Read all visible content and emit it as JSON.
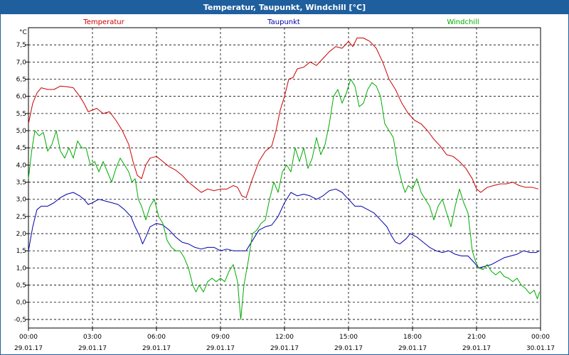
{
  "window": {
    "title": "Temperatur, Taupunkt, Windchill [°C]"
  },
  "chart_data": {
    "type": "line",
    "title": "Temperatur, Taupunkt, Windchill [°C]",
    "ylabel": "°C",
    "xlabel": "",
    "ylim": [
      -0.75,
      8.0
    ],
    "y_ticks": [
      -0.5,
      0.0,
      0.5,
      1.0,
      1.5,
      2.0,
      2.5,
      3.0,
      3.5,
      4.0,
      4.5,
      5.0,
      5.5,
      6.0,
      6.5,
      7.0,
      7.5
    ],
    "y_tick_labels": [
      "-0,5",
      "0,0",
      "0,5",
      "1,0",
      "1,5",
      "2,0",
      "2,5",
      "3,0",
      "3,5",
      "4,0",
      "4,5",
      "5,0",
      "5,5",
      "6,0",
      "6,5",
      "7,0",
      "7,5"
    ],
    "xlim": [
      0,
      24
    ],
    "x_ticks": [
      0,
      3,
      6,
      9,
      12,
      15,
      18,
      21,
      24
    ],
    "x_tick_labels": [
      {
        "time": "00:00",
        "date": "29.01.17"
      },
      {
        "time": "03:00",
        "date": "29.01.17"
      },
      {
        "time": "06:00",
        "date": "29.01.17"
      },
      {
        "time": "09:00",
        "date": "29.01.17"
      },
      {
        "time": "12:00",
        "date": "29.01.17"
      },
      {
        "time": "15:00",
        "date": "29.01.17"
      },
      {
        "time": "18:00",
        "date": "29.01.17"
      },
      {
        "time": "21:00",
        "date": "29.01.17"
      },
      {
        "time": "00:00",
        "date": "30.01.17"
      }
    ],
    "grid": true,
    "legend_position": "top",
    "series": [
      {
        "name": "Temperatur",
        "color": "#cc0000",
        "points": [
          [
            0,
            5.2
          ],
          [
            0.2,
            5.8
          ],
          [
            0.4,
            6.1
          ],
          [
            0.6,
            6.25
          ],
          [
            0.9,
            6.2
          ],
          [
            1.2,
            6.2
          ],
          [
            1.5,
            6.3
          ],
          [
            1.8,
            6.28
          ],
          [
            2.1,
            6.25
          ],
          [
            2.4,
            6.0
          ],
          [
            2.6,
            5.8
          ],
          [
            2.8,
            5.55
          ],
          [
            3.0,
            5.6
          ],
          [
            3.2,
            5.65
          ],
          [
            3.5,
            5.5
          ],
          [
            3.8,
            5.55
          ],
          [
            4.1,
            5.3
          ],
          [
            4.4,
            5.0
          ],
          [
            4.7,
            4.6
          ],
          [
            4.9,
            4.1
          ],
          [
            5.1,
            3.7
          ],
          [
            5.3,
            3.6
          ],
          [
            5.5,
            4.0
          ],
          [
            5.7,
            4.2
          ],
          [
            6.0,
            4.25
          ],
          [
            6.3,
            4.1
          ],
          [
            6.6,
            3.95
          ],
          [
            6.9,
            3.85
          ],
          [
            7.2,
            3.7
          ],
          [
            7.5,
            3.5
          ],
          [
            7.8,
            3.35
          ],
          [
            8.1,
            3.2
          ],
          [
            8.4,
            3.3
          ],
          [
            8.7,
            3.25
          ],
          [
            9.0,
            3.3
          ],
          [
            9.3,
            3.3
          ],
          [
            9.6,
            3.4
          ],
          [
            9.8,
            3.35
          ],
          [
            10.0,
            3.1
          ],
          [
            10.2,
            3.05
          ],
          [
            10.5,
            3.6
          ],
          [
            10.8,
            4.1
          ],
          [
            11.1,
            4.4
          ],
          [
            11.4,
            4.55
          ],
          [
            11.6,
            5.0
          ],
          [
            11.8,
            5.6
          ],
          [
            12.0,
            6.0
          ],
          [
            12.2,
            6.5
          ],
          [
            12.4,
            6.55
          ],
          [
            12.6,
            6.8
          ],
          [
            12.9,
            6.85
          ],
          [
            13.2,
            7.0
          ],
          [
            13.5,
            6.9
          ],
          [
            13.8,
            7.1
          ],
          [
            14.1,
            7.3
          ],
          [
            14.4,
            7.45
          ],
          [
            14.7,
            7.4
          ],
          [
            15.0,
            7.6
          ],
          [
            15.2,
            7.45
          ],
          [
            15.4,
            7.7
          ],
          [
            15.7,
            7.7
          ],
          [
            16.0,
            7.6
          ],
          [
            16.3,
            7.4
          ],
          [
            16.6,
            7.0
          ],
          [
            16.9,
            6.5
          ],
          [
            17.2,
            6.2
          ],
          [
            17.5,
            5.8
          ],
          [
            17.8,
            5.5
          ],
          [
            18.1,
            5.3
          ],
          [
            18.4,
            5.2
          ],
          [
            18.7,
            5.0
          ],
          [
            19.0,
            4.75
          ],
          [
            19.3,
            4.55
          ],
          [
            19.6,
            4.3
          ],
          [
            19.9,
            4.25
          ],
          [
            20.2,
            4.1
          ],
          [
            20.5,
            3.9
          ],
          [
            20.8,
            3.6
          ],
          [
            21.0,
            3.3
          ],
          [
            21.2,
            3.2
          ],
          [
            21.5,
            3.35
          ],
          [
            21.8,
            3.4
          ],
          [
            22.1,
            3.45
          ],
          [
            22.4,
            3.45
          ],
          [
            22.7,
            3.5
          ],
          [
            23.0,
            3.4
          ],
          [
            23.3,
            3.35
          ],
          [
            23.6,
            3.35
          ],
          [
            23.9,
            3.3
          ]
        ]
      },
      {
        "name": "Taupunkt",
        "color": "#0000aa",
        "points": [
          [
            0,
            1.5
          ],
          [
            0.2,
            2.2
          ],
          [
            0.4,
            2.7
          ],
          [
            0.6,
            2.8
          ],
          [
            0.9,
            2.8
          ],
          [
            1.2,
            2.9
          ],
          [
            1.5,
            3.05
          ],
          [
            1.8,
            3.15
          ],
          [
            2.1,
            3.2
          ],
          [
            2.4,
            3.1
          ],
          [
            2.6,
            3.0
          ],
          [
            2.8,
            2.85
          ],
          [
            3.0,
            2.9
          ],
          [
            3.3,
            3.0
          ],
          [
            3.6,
            2.95
          ],
          [
            3.9,
            2.9
          ],
          [
            4.2,
            2.85
          ],
          [
            4.5,
            2.7
          ],
          [
            4.8,
            2.5
          ],
          [
            5.0,
            2.2
          ],
          [
            5.2,
            1.95
          ],
          [
            5.35,
            1.7
          ],
          [
            5.5,
            1.9
          ],
          [
            5.7,
            2.2
          ],
          [
            6.0,
            2.3
          ],
          [
            6.3,
            2.25
          ],
          [
            6.6,
            2.1
          ],
          [
            6.9,
            1.9
          ],
          [
            7.2,
            1.75
          ],
          [
            7.5,
            1.7
          ],
          [
            7.8,
            1.6
          ],
          [
            8.1,
            1.55
          ],
          [
            8.4,
            1.6
          ],
          [
            8.7,
            1.6
          ],
          [
            9.0,
            1.5
          ],
          [
            9.3,
            1.55
          ],
          [
            9.6,
            1.5
          ],
          [
            9.9,
            1.5
          ],
          [
            10.2,
            1.5
          ],
          [
            10.5,
            1.8
          ],
          [
            10.8,
            2.1
          ],
          [
            11.1,
            2.2
          ],
          [
            11.4,
            2.25
          ],
          [
            11.7,
            2.5
          ],
          [
            12.0,
            2.9
          ],
          [
            12.3,
            3.2
          ],
          [
            12.6,
            3.1
          ],
          [
            12.9,
            3.15
          ],
          [
            13.2,
            3.1
          ],
          [
            13.5,
            3.0
          ],
          [
            13.8,
            3.1
          ],
          [
            14.1,
            3.25
          ],
          [
            14.4,
            3.3
          ],
          [
            14.7,
            3.2
          ],
          [
            15.0,
            3.0
          ],
          [
            15.3,
            2.8
          ],
          [
            15.6,
            2.8
          ],
          [
            15.9,
            2.7
          ],
          [
            16.2,
            2.6
          ],
          [
            16.5,
            2.4
          ],
          [
            16.8,
            2.2
          ],
          [
            17.0,
            1.95
          ],
          [
            17.2,
            1.75
          ],
          [
            17.4,
            1.7
          ],
          [
            17.7,
            1.85
          ],
          [
            17.9,
            2.0
          ],
          [
            18.2,
            1.9
          ],
          [
            18.5,
            1.75
          ],
          [
            18.8,
            1.6
          ],
          [
            19.1,
            1.5
          ],
          [
            19.4,
            1.45
          ],
          [
            19.7,
            1.5
          ],
          [
            20.0,
            1.4
          ],
          [
            20.3,
            1.35
          ],
          [
            20.6,
            1.35
          ],
          [
            20.9,
            1.15
          ],
          [
            21.1,
            1.0
          ],
          [
            21.4,
            1.05
          ],
          [
            21.7,
            1.1
          ],
          [
            22.0,
            1.2
          ],
          [
            22.3,
            1.3
          ],
          [
            22.6,
            1.35
          ],
          [
            22.9,
            1.4
          ],
          [
            23.2,
            1.5
          ],
          [
            23.5,
            1.45
          ],
          [
            23.8,
            1.45
          ],
          [
            23.95,
            1.5
          ]
        ]
      },
      {
        "name": "Windchill",
        "color": "#00aa00",
        "points": [
          [
            0,
            3.6
          ],
          [
            0.15,
            4.4
          ],
          [
            0.3,
            5.0
          ],
          [
            0.5,
            4.85
          ],
          [
            0.7,
            4.95
          ],
          [
            0.9,
            4.4
          ],
          [
            1.1,
            4.6
          ],
          [
            1.3,
            5.0
          ],
          [
            1.5,
            4.4
          ],
          [
            1.7,
            4.2
          ],
          [
            1.9,
            4.5
          ],
          [
            2.1,
            4.2
          ],
          [
            2.3,
            4.7
          ],
          [
            2.5,
            4.5
          ],
          [
            2.7,
            4.5
          ],
          [
            2.9,
            4.0
          ],
          [
            3.1,
            4.1
          ],
          [
            3.3,
            3.8
          ],
          [
            3.5,
            4.1
          ],
          [
            3.7,
            3.8
          ],
          [
            3.9,
            3.5
          ],
          [
            4.1,
            3.9
          ],
          [
            4.3,
            4.2
          ],
          [
            4.5,
            4.0
          ],
          [
            4.7,
            3.8
          ],
          [
            4.85,
            3.5
          ],
          [
            5.0,
            3.6
          ],
          [
            5.15,
            3.0
          ],
          [
            5.3,
            2.8
          ],
          [
            5.5,
            2.4
          ],
          [
            5.7,
            2.8
          ],
          [
            5.9,
            3.0
          ],
          [
            6.1,
            2.5
          ],
          [
            6.3,
            2.3
          ],
          [
            6.5,
            1.8
          ],
          [
            6.7,
            1.6
          ],
          [
            6.9,
            1.5
          ],
          [
            7.1,
            1.5
          ],
          [
            7.3,
            1.3
          ],
          [
            7.5,
            1.0
          ],
          [
            7.7,
            0.5
          ],
          [
            7.85,
            0.3
          ],
          [
            8.0,
            0.5
          ],
          [
            8.2,
            0.3
          ],
          [
            8.4,
            0.6
          ],
          [
            8.6,
            0.7
          ],
          [
            8.8,
            0.6
          ],
          [
            9.0,
            0.7
          ],
          [
            9.2,
            0.6
          ],
          [
            9.4,
            0.9
          ],
          [
            9.6,
            1.1
          ],
          [
            9.8,
            0.6
          ],
          [
            9.95,
            -0.5
          ],
          [
            10.1,
            0.5
          ],
          [
            10.3,
            1.2
          ],
          [
            10.5,
            2.0
          ],
          [
            10.7,
            2.1
          ],
          [
            10.9,
            2.3
          ],
          [
            11.1,
            2.4
          ],
          [
            11.3,
            3.0
          ],
          [
            11.5,
            3.5
          ],
          [
            11.7,
            3.2
          ],
          [
            11.9,
            3.8
          ],
          [
            12.1,
            4.0
          ],
          [
            12.3,
            3.8
          ],
          [
            12.5,
            4.5
          ],
          [
            12.7,
            4.1
          ],
          [
            12.9,
            4.5
          ],
          [
            13.1,
            3.9
          ],
          [
            13.3,
            4.2
          ],
          [
            13.5,
            4.8
          ],
          [
            13.7,
            4.3
          ],
          [
            13.9,
            4.6
          ],
          [
            14.1,
            5.2
          ],
          [
            14.3,
            6.0
          ],
          [
            14.5,
            6.2
          ],
          [
            14.7,
            5.8
          ],
          [
            14.9,
            6.1
          ],
          [
            15.1,
            6.5
          ],
          [
            15.3,
            6.3
          ],
          [
            15.5,
            5.7
          ],
          [
            15.7,
            5.8
          ],
          [
            15.9,
            6.2
          ],
          [
            16.1,
            6.4
          ],
          [
            16.3,
            6.3
          ],
          [
            16.5,
            6.0
          ],
          [
            16.7,
            5.2
          ],
          [
            16.9,
            5.0
          ],
          [
            17.1,
            4.8
          ],
          [
            17.3,
            4.0
          ],
          [
            17.5,
            3.5
          ],
          [
            17.65,
            3.2
          ],
          [
            17.8,
            3.4
          ],
          [
            18.0,
            3.3
          ],
          [
            18.2,
            3.6
          ],
          [
            18.4,
            3.2
          ],
          [
            18.6,
            3.0
          ],
          [
            18.8,
            2.8
          ],
          [
            19.0,
            2.4
          ],
          [
            19.2,
            2.8
          ],
          [
            19.4,
            3.0
          ],
          [
            19.6,
            2.6
          ],
          [
            19.8,
            2.2
          ],
          [
            20.0,
            2.8
          ],
          [
            20.2,
            3.3
          ],
          [
            20.4,
            2.9
          ],
          [
            20.6,
            2.6
          ],
          [
            20.8,
            1.5
          ],
          [
            20.95,
            1.2
          ],
          [
            21.1,
            1.0
          ],
          [
            21.3,
            0.95
          ],
          [
            21.5,
            1.1
          ],
          [
            21.7,
            0.9
          ],
          [
            21.9,
            0.8
          ],
          [
            22.1,
            0.9
          ],
          [
            22.3,
            0.75
          ],
          [
            22.5,
            0.7
          ],
          [
            22.7,
            0.6
          ],
          [
            22.9,
            0.7
          ],
          [
            23.1,
            0.5
          ],
          [
            23.3,
            0.4
          ],
          [
            23.5,
            0.25
          ],
          [
            23.7,
            0.35
          ],
          [
            23.85,
            0.1
          ],
          [
            23.95,
            0.3
          ]
        ]
      }
    ]
  }
}
